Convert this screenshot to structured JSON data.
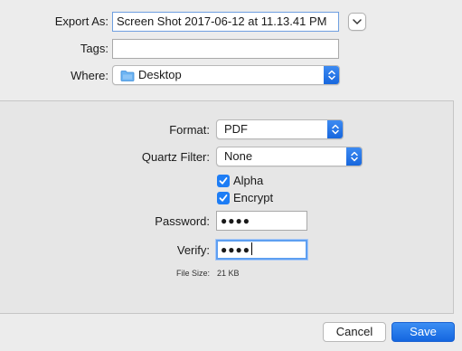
{
  "export": {
    "export_as_label": "Export As:",
    "filename": "Screen Shot 2017-06-12 at 11.13.41 PM",
    "tags_label": "Tags:",
    "tags_value": "",
    "where_label": "Where:",
    "where_value": "Desktop"
  },
  "options": {
    "format_label": "Format:",
    "format_value": "PDF",
    "quartz_label": "Quartz Filter:",
    "quartz_value": "None",
    "alpha_label": "Alpha",
    "alpha_checked": true,
    "encrypt_label": "Encrypt",
    "encrypt_checked": true,
    "password_label": "Password:",
    "password_value": "●●●●",
    "verify_label": "Verify:",
    "verify_value": "●●●●",
    "file_size_label": "File Size:",
    "file_size_value": "21 KB"
  },
  "buttons": {
    "cancel_label": "Cancel",
    "save_label": "Save"
  },
  "colors": {
    "accent": "#1d7df5",
    "background": "#ececec",
    "panel": "#e6e6e6"
  },
  "icons": {
    "disclosure": "chevron-down-icon",
    "folder": "folder-icon",
    "popup_arrows": "up-down-arrows-icon",
    "check": "checkmark-icon"
  }
}
